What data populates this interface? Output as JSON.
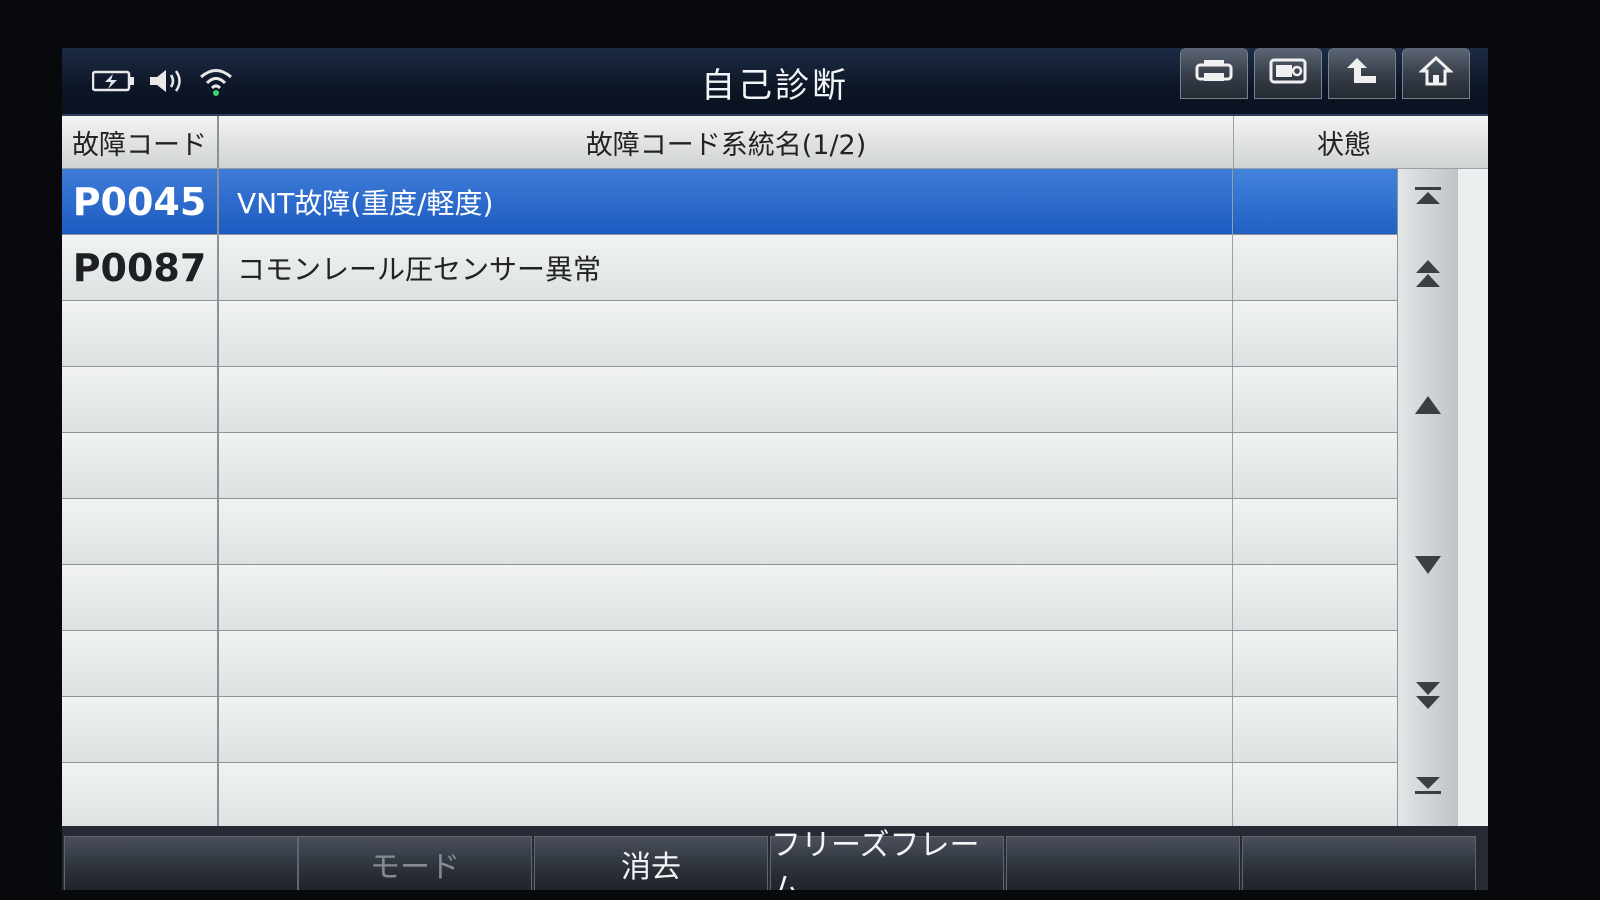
{
  "app": {
    "title": "自己診断"
  },
  "table": {
    "headers": {
      "code": "故障コード",
      "name": "故障コード系統名(1/2)",
      "state": "状態"
    },
    "rows": [
      {
        "code": "P0045",
        "name": "VNT故障(重度/軽度)",
        "state": "",
        "selected": true
      },
      {
        "code": "P0087",
        "name": "コモンレール圧センサー異常",
        "state": "",
        "selected": false
      },
      {
        "code": "",
        "name": "",
        "state": "",
        "selected": false
      },
      {
        "code": "",
        "name": "",
        "state": "",
        "selected": false
      },
      {
        "code": "",
        "name": "",
        "state": "",
        "selected": false
      },
      {
        "code": "",
        "name": "",
        "state": "",
        "selected": false
      },
      {
        "code": "",
        "name": "",
        "state": "",
        "selected": false
      },
      {
        "code": "",
        "name": "",
        "state": "",
        "selected": false
      },
      {
        "code": "",
        "name": "",
        "state": "",
        "selected": false
      },
      {
        "code": "",
        "name": "",
        "state": "",
        "selected": false
      }
    ]
  },
  "bottom_buttons": [
    {
      "label": "",
      "enabled": false
    },
    {
      "label": "モード",
      "enabled": false
    },
    {
      "label": "消去",
      "enabled": true
    },
    {
      "label": "フリーズフレーム",
      "enabled": true
    },
    {
      "label": "",
      "enabled": false
    },
    {
      "label": "",
      "enabled": false
    }
  ],
  "icons": {
    "status": [
      "battery-icon",
      "speaker-icon",
      "wifi-icon"
    ],
    "toolbar": [
      "print-icon",
      "screenshot-icon",
      "back-icon",
      "home-icon"
    ],
    "scroll": [
      "scroll-top-icon",
      "page-up-icon",
      "scroll-up-icon",
      "scroll-down-icon",
      "page-down-icon",
      "scroll-bottom-icon"
    ]
  },
  "colors": {
    "selection": "#2a66c9",
    "titlebar": "#0d1626",
    "row_bg": "#e6e9e9"
  }
}
